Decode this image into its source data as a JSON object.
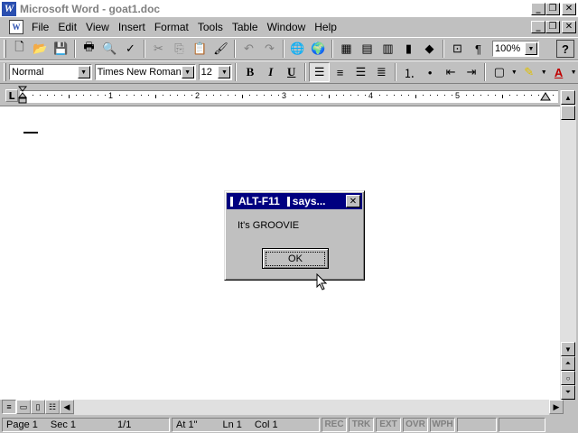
{
  "window": {
    "title": "Microsoft Word - goat1.doc",
    "app_icon_glyph": "W",
    "buttons": {
      "minimize": "_",
      "restore": "❐",
      "close": "✕"
    }
  },
  "menubar": {
    "items": [
      "File",
      "Edit",
      "View",
      "Insert",
      "Format",
      "Tools",
      "Table",
      "Window",
      "Help"
    ],
    "doc_buttons": {
      "minimize": "_",
      "restore": "❐",
      "close": "✕"
    }
  },
  "standard_toolbar": {
    "zoom": "100%",
    "help_glyph": "?"
  },
  "format_toolbar": {
    "style": "Normal",
    "font": "Times New Roman",
    "size": "12",
    "bold": "B",
    "italic": "I",
    "underline": "U",
    "font_color_glyph": "A"
  },
  "ruler": {
    "numbers": [
      "1",
      "2",
      "3",
      "4",
      "5"
    ],
    "tab_selector": "L"
  },
  "dialog": {
    "title": "ALT-F11",
    "title_suffix": "says...",
    "message": "It's GROOVIE",
    "ok_label": "OK",
    "close_glyph": "✕"
  },
  "statusbar": {
    "page": "Page 1",
    "sec": "Sec 1",
    "pages": "1/1",
    "at": "At 1\"",
    "ln": "Ln 1",
    "col": "Col 1",
    "rec": "REC",
    "trk": "TRK",
    "ext": "EXT",
    "ovr": "OVR",
    "wph": "WPH"
  }
}
